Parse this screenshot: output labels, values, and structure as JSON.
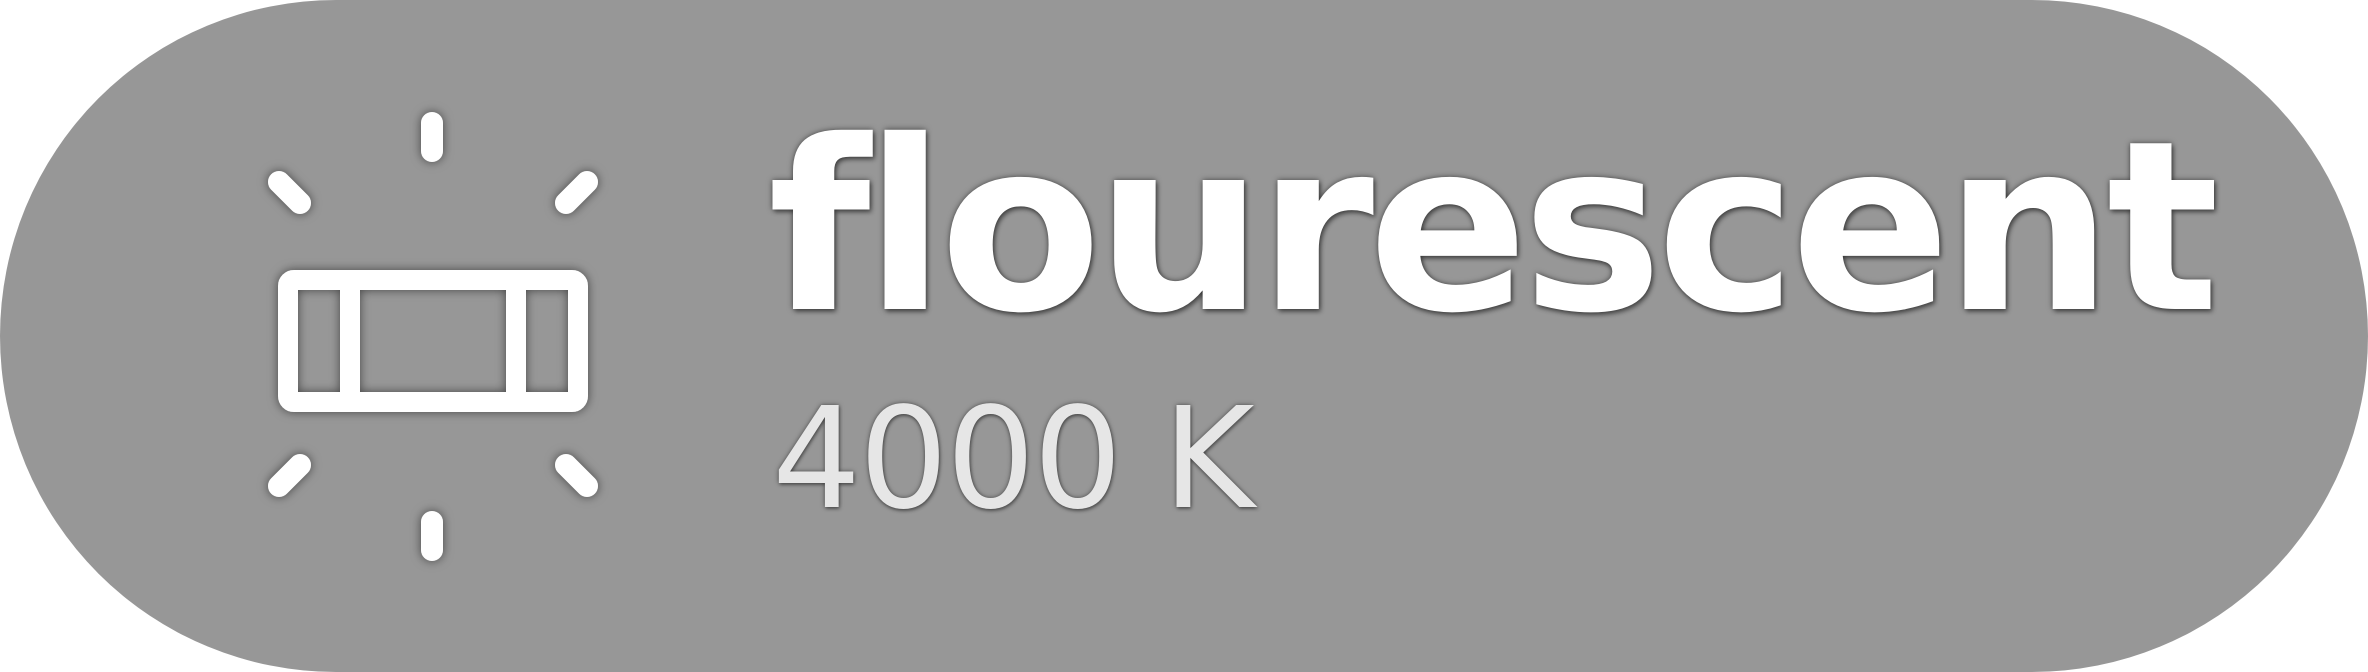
{
  "tile": {
    "title": "flourescent",
    "subtitle": "4000 K",
    "icon": "fluorescent-lamp-icon",
    "background_color": "#979797",
    "text_color": "#ffffff",
    "subtitle_color": "#e6e6e6"
  }
}
